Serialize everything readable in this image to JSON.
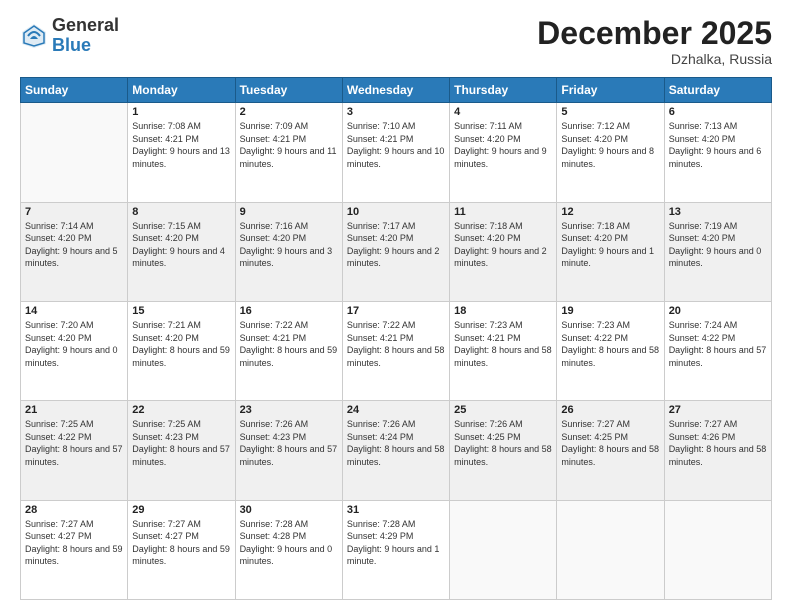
{
  "header": {
    "logo_general": "General",
    "logo_blue": "Blue",
    "month_title": "December 2025",
    "location": "Dzhalka, Russia"
  },
  "weekdays": [
    "Sunday",
    "Monday",
    "Tuesday",
    "Wednesday",
    "Thursday",
    "Friday",
    "Saturday"
  ],
  "weeks": [
    [
      {
        "num": "",
        "sunrise": "",
        "sunset": "",
        "daylight": "",
        "empty": true
      },
      {
        "num": "1",
        "sunrise": "Sunrise: 7:08 AM",
        "sunset": "Sunset: 4:21 PM",
        "daylight": "Daylight: 9 hours and 13 minutes."
      },
      {
        "num": "2",
        "sunrise": "Sunrise: 7:09 AM",
        "sunset": "Sunset: 4:21 PM",
        "daylight": "Daylight: 9 hours and 11 minutes."
      },
      {
        "num": "3",
        "sunrise": "Sunrise: 7:10 AM",
        "sunset": "Sunset: 4:21 PM",
        "daylight": "Daylight: 9 hours and 10 minutes."
      },
      {
        "num": "4",
        "sunrise": "Sunrise: 7:11 AM",
        "sunset": "Sunset: 4:20 PM",
        "daylight": "Daylight: 9 hours and 9 minutes."
      },
      {
        "num": "5",
        "sunrise": "Sunrise: 7:12 AM",
        "sunset": "Sunset: 4:20 PM",
        "daylight": "Daylight: 9 hours and 8 minutes."
      },
      {
        "num": "6",
        "sunrise": "Sunrise: 7:13 AM",
        "sunset": "Sunset: 4:20 PM",
        "daylight": "Daylight: 9 hours and 6 minutes."
      }
    ],
    [
      {
        "num": "7",
        "sunrise": "Sunrise: 7:14 AM",
        "sunset": "Sunset: 4:20 PM",
        "daylight": "Daylight: 9 hours and 5 minutes."
      },
      {
        "num": "8",
        "sunrise": "Sunrise: 7:15 AM",
        "sunset": "Sunset: 4:20 PM",
        "daylight": "Daylight: 9 hours and 4 minutes."
      },
      {
        "num": "9",
        "sunrise": "Sunrise: 7:16 AM",
        "sunset": "Sunset: 4:20 PM",
        "daylight": "Daylight: 9 hours and 3 minutes."
      },
      {
        "num": "10",
        "sunrise": "Sunrise: 7:17 AM",
        "sunset": "Sunset: 4:20 PM",
        "daylight": "Daylight: 9 hours and 2 minutes."
      },
      {
        "num": "11",
        "sunrise": "Sunrise: 7:18 AM",
        "sunset": "Sunset: 4:20 PM",
        "daylight": "Daylight: 9 hours and 2 minutes."
      },
      {
        "num": "12",
        "sunrise": "Sunrise: 7:18 AM",
        "sunset": "Sunset: 4:20 PM",
        "daylight": "Daylight: 9 hours and 1 minute."
      },
      {
        "num": "13",
        "sunrise": "Sunrise: 7:19 AM",
        "sunset": "Sunset: 4:20 PM",
        "daylight": "Daylight: 9 hours and 0 minutes."
      }
    ],
    [
      {
        "num": "14",
        "sunrise": "Sunrise: 7:20 AM",
        "sunset": "Sunset: 4:20 PM",
        "daylight": "Daylight: 9 hours and 0 minutes."
      },
      {
        "num": "15",
        "sunrise": "Sunrise: 7:21 AM",
        "sunset": "Sunset: 4:20 PM",
        "daylight": "Daylight: 8 hours and 59 minutes."
      },
      {
        "num": "16",
        "sunrise": "Sunrise: 7:22 AM",
        "sunset": "Sunset: 4:21 PM",
        "daylight": "Daylight: 8 hours and 59 minutes."
      },
      {
        "num": "17",
        "sunrise": "Sunrise: 7:22 AM",
        "sunset": "Sunset: 4:21 PM",
        "daylight": "Daylight: 8 hours and 58 minutes."
      },
      {
        "num": "18",
        "sunrise": "Sunrise: 7:23 AM",
        "sunset": "Sunset: 4:21 PM",
        "daylight": "Daylight: 8 hours and 58 minutes."
      },
      {
        "num": "19",
        "sunrise": "Sunrise: 7:23 AM",
        "sunset": "Sunset: 4:22 PM",
        "daylight": "Daylight: 8 hours and 58 minutes."
      },
      {
        "num": "20",
        "sunrise": "Sunrise: 7:24 AM",
        "sunset": "Sunset: 4:22 PM",
        "daylight": "Daylight: 8 hours and 57 minutes."
      }
    ],
    [
      {
        "num": "21",
        "sunrise": "Sunrise: 7:25 AM",
        "sunset": "Sunset: 4:22 PM",
        "daylight": "Daylight: 8 hours and 57 minutes."
      },
      {
        "num": "22",
        "sunrise": "Sunrise: 7:25 AM",
        "sunset": "Sunset: 4:23 PM",
        "daylight": "Daylight: 8 hours and 57 minutes."
      },
      {
        "num": "23",
        "sunrise": "Sunrise: 7:26 AM",
        "sunset": "Sunset: 4:23 PM",
        "daylight": "Daylight: 8 hours and 57 minutes."
      },
      {
        "num": "24",
        "sunrise": "Sunrise: 7:26 AM",
        "sunset": "Sunset: 4:24 PM",
        "daylight": "Daylight: 8 hours and 58 minutes."
      },
      {
        "num": "25",
        "sunrise": "Sunrise: 7:26 AM",
        "sunset": "Sunset: 4:25 PM",
        "daylight": "Daylight: 8 hours and 58 minutes."
      },
      {
        "num": "26",
        "sunrise": "Sunrise: 7:27 AM",
        "sunset": "Sunset: 4:25 PM",
        "daylight": "Daylight: 8 hours and 58 minutes."
      },
      {
        "num": "27",
        "sunrise": "Sunrise: 7:27 AM",
        "sunset": "Sunset: 4:26 PM",
        "daylight": "Daylight: 8 hours and 58 minutes."
      }
    ],
    [
      {
        "num": "28",
        "sunrise": "Sunrise: 7:27 AM",
        "sunset": "Sunset: 4:27 PM",
        "daylight": "Daylight: 8 hours and 59 minutes."
      },
      {
        "num": "29",
        "sunrise": "Sunrise: 7:27 AM",
        "sunset": "Sunset: 4:27 PM",
        "daylight": "Daylight: 8 hours and 59 minutes."
      },
      {
        "num": "30",
        "sunrise": "Sunrise: 7:28 AM",
        "sunset": "Sunset: 4:28 PM",
        "daylight": "Daylight: 9 hours and 0 minutes."
      },
      {
        "num": "31",
        "sunrise": "Sunrise: 7:28 AM",
        "sunset": "Sunset: 4:29 PM",
        "daylight": "Daylight: 9 hours and 1 minute."
      },
      {
        "num": "",
        "sunrise": "",
        "sunset": "",
        "daylight": "",
        "empty": true
      },
      {
        "num": "",
        "sunrise": "",
        "sunset": "",
        "daylight": "",
        "empty": true
      },
      {
        "num": "",
        "sunrise": "",
        "sunset": "",
        "daylight": "",
        "empty": true
      }
    ]
  ]
}
